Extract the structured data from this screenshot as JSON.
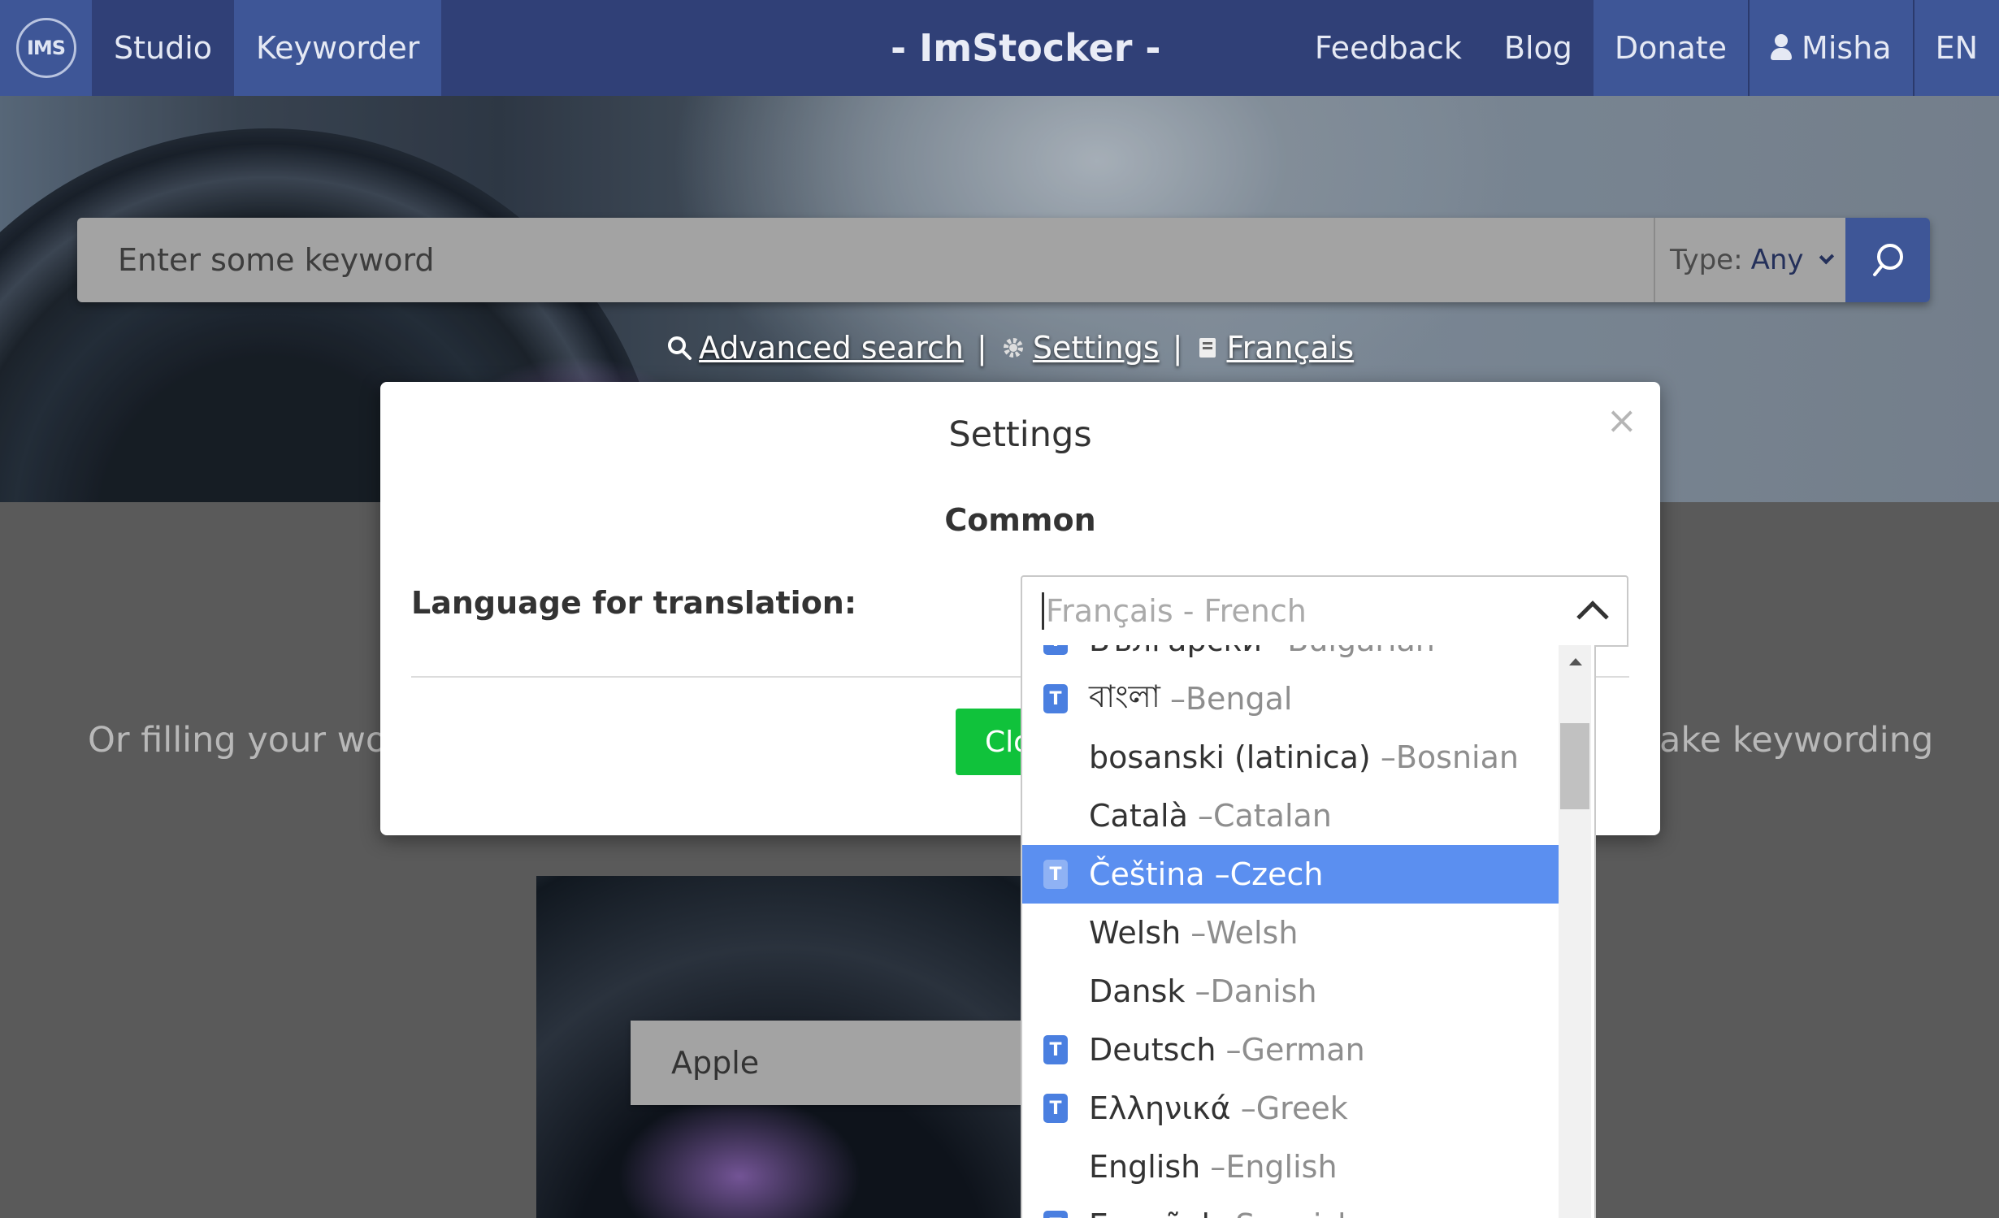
{
  "nav": {
    "logo": "IMS",
    "studio": "Studio",
    "keyworder": "Keyworder",
    "brand": "- ImStocker -",
    "feedback": "Feedback",
    "blog": "Blog",
    "donate": "Donate",
    "user": "Misha",
    "lang": "EN"
  },
  "search": {
    "placeholder": "Enter some keyword",
    "type_label": "Type:",
    "type_value": "Any"
  },
  "links": {
    "advanced": "Advanced search",
    "settings": "Settings",
    "language": "Français"
  },
  "page": {
    "tagline_left": "Or filling your wo",
    "tagline_right": "ake keywording",
    "card_label": "Apple"
  },
  "modal": {
    "title": "Settings",
    "close": "×",
    "section": "Common",
    "field_label": "Language for translation:",
    "select_placeholder": "Français - French",
    "close_button": "Close"
  },
  "languages": [
    {
      "native": "Български",
      "english": "Bulgarian",
      "t": true
    },
    {
      "native": "বাংলা",
      "english": "Bengal",
      "t": true
    },
    {
      "native": "bosanski (latinica)",
      "english": "Bosnian",
      "t": false
    },
    {
      "native": "Català",
      "english": "Catalan",
      "t": false
    },
    {
      "native": "Čeština",
      "english": "Czech",
      "t": true,
      "selected": true
    },
    {
      "native": "Welsh",
      "english": "Welsh",
      "t": false
    },
    {
      "native": "Dansk",
      "english": "Danish",
      "t": false
    },
    {
      "native": "Deutsch",
      "english": "German",
      "t": true
    },
    {
      "native": "Ελληνικά",
      "english": "Greek",
      "t": true
    },
    {
      "native": "English",
      "english": "English",
      "t": false
    },
    {
      "native": "Español",
      "english": "Spanish",
      "t": true
    }
  ],
  "colors": {
    "nav": "#304077",
    "nav_active": "#3e5697",
    "selected": "#5b8ff0",
    "close_button": "#10c23b"
  }
}
